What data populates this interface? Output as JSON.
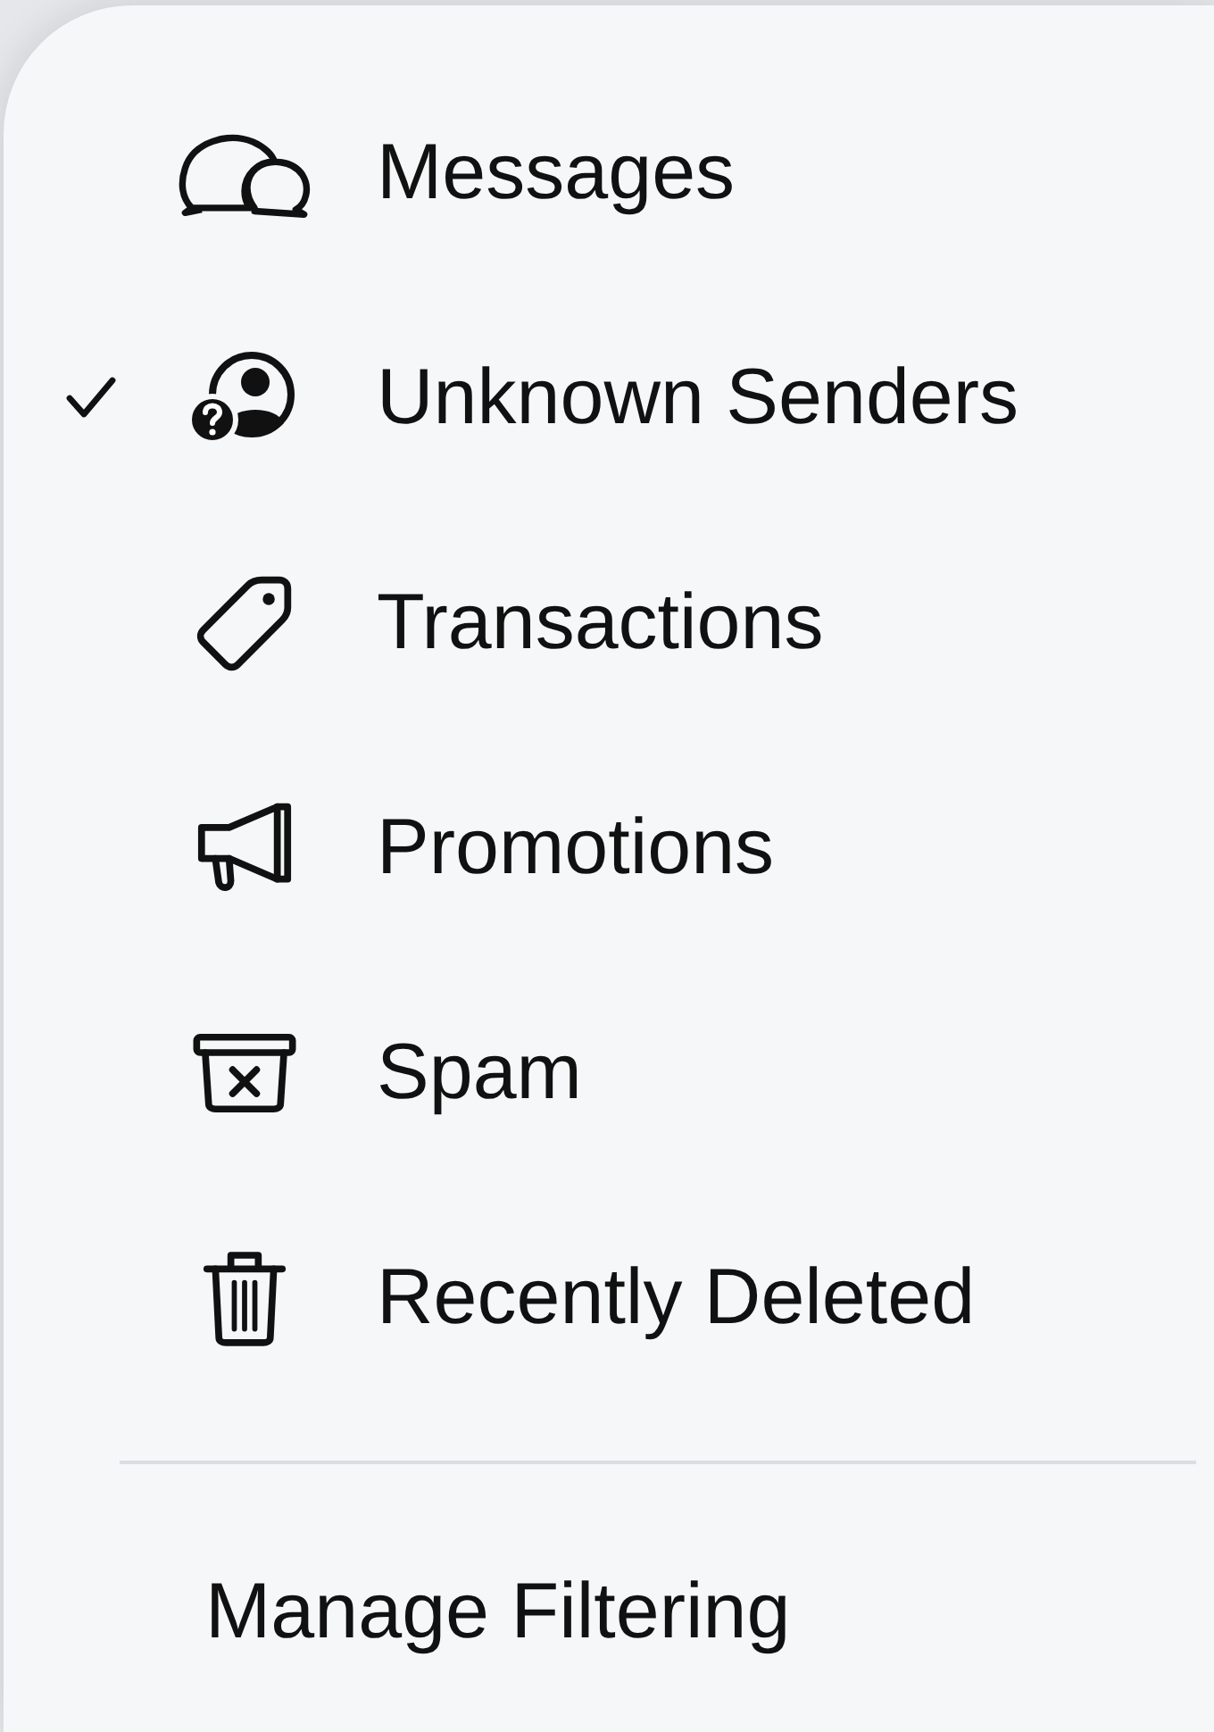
{
  "menu": {
    "items": [
      {
        "label": "Messages",
        "selected": false
      },
      {
        "label": "Unknown Senders",
        "selected": true
      },
      {
        "label": "Transactions",
        "selected": false
      },
      {
        "label": "Promotions",
        "selected": false
      },
      {
        "label": "Spam",
        "selected": false
      },
      {
        "label": "Recently Deleted",
        "selected": false
      }
    ],
    "footer_action": "Manage Filtering"
  }
}
